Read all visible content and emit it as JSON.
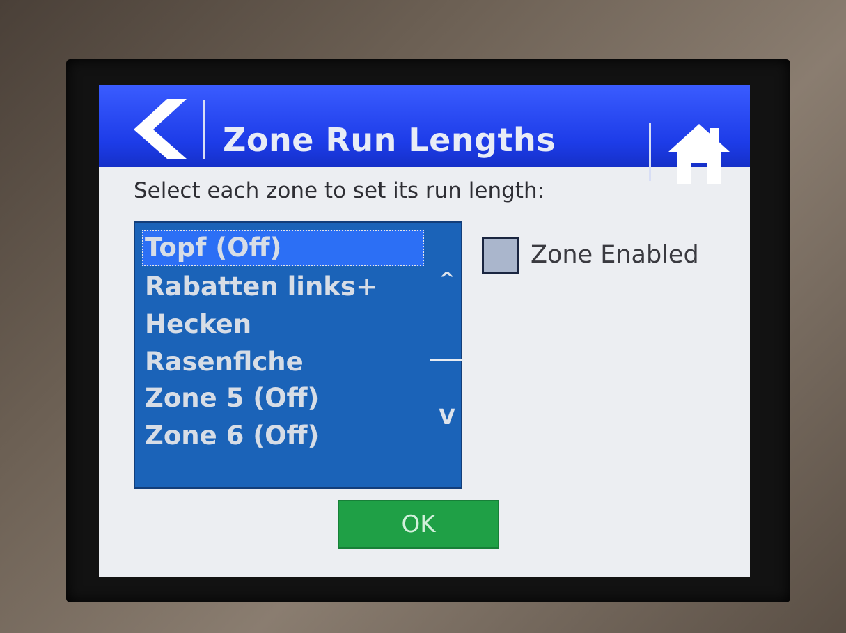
{
  "header": {
    "title": "Zone Run Lengths",
    "back_icon": "chevron-left-icon",
    "home_icon": "home-icon",
    "color": "#1d3ce8"
  },
  "instruction": "Select each zone to set its run length:",
  "zones": {
    "items": [
      {
        "label": "Topf (Off)",
        "selected": true
      },
      {
        "label": "Rabatten links+",
        "selected": false
      },
      {
        "label": "Hecken",
        "selected": false
      },
      {
        "label": "Rasenflche",
        "selected": false
      },
      {
        "label": "Zone 5 (Off)",
        "selected": false
      },
      {
        "label": "Zone 6 (Off)",
        "selected": false
      }
    ],
    "scroll_up": "^",
    "scroll_down": "V",
    "list_color": "#1b63b8"
  },
  "zone_enabled": {
    "label": "Zone Enabled",
    "checked": false
  },
  "ok_button": {
    "label": "OK",
    "color": "#1fa046"
  }
}
